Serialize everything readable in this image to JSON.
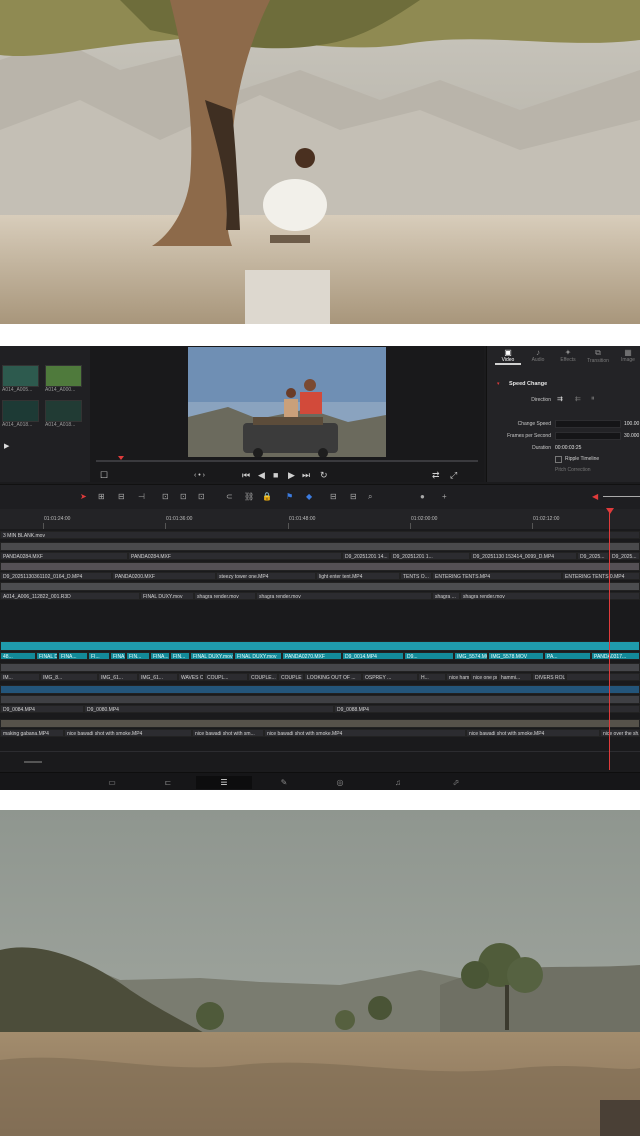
{
  "media_pool": {
    "clips": [
      {
        "label": "A014_A005..."
      },
      {
        "label": "A014_A000..."
      },
      {
        "label": "A014_A018..."
      },
      {
        "label": "A014_A018..."
      }
    ]
  },
  "inspector": {
    "tabs": [
      {
        "label": "Video",
        "icon": "video-icon"
      },
      {
        "label": "Audio",
        "icon": "audio-icon"
      },
      {
        "label": "Effects",
        "icon": "effects-icon"
      },
      {
        "label": "Transition",
        "icon": "transition-icon"
      },
      {
        "label": "Image",
        "icon": "image-icon"
      }
    ],
    "section_title": "Speed Change",
    "direction_label": "Direction",
    "change_speed_label": "Change Speed",
    "change_speed_value": "100.00",
    "fps_label": "Frames per Second",
    "fps_value": "30.000",
    "duration_label": "Duration",
    "duration_value": "00:00:03:25",
    "ripple_label": "Ripple Timeline",
    "pitch_label": "Pitch Correction",
    "ripple_checked": false
  },
  "ruler": {
    "timecodes": [
      "01:01:24:00",
      "01:01:36:00",
      "01:01:48:00",
      "01:02:00:00",
      "01:02:12:00"
    ]
  },
  "tracks": {
    "title_row": "3 MIN BLANK.mov",
    "row2": [
      "PANDA0284.MXF",
      "PANDA0284.MXF",
      "D9_20251201 14...",
      "D9_20251201 1...",
      "D9_20251130 153414_0099_D.MP4",
      "D9_2025...",
      "D9_2025..."
    ],
    "row3": [
      "D9_20251130361102_0164_D.MP4",
      "PANDA0200.MXF",
      "steezy tower one.MP4",
      "light enter tent.MP4",
      "TENTS O...",
      "ENTERING TENTS.MP4",
      "ENTERING TENTS 0.MP4"
    ],
    "row4": [
      "A014_A006_112822_001.R3D",
      "FINAL DUXY.mov",
      "shagra render.mov",
      "shagra render.mov",
      "shagra ...",
      "shagra render.mov"
    ],
    "teal_row": [
      "48...",
      "FINAL D...",
      "FINA...",
      "FI...",
      "FINA...",
      "FIN...",
      "FINA...",
      "FIN...",
      "FINAL DUXY.mov",
      "FINAL DUXY.mov",
      "PANDA0270.MXF",
      "D9_0014.MP4",
      "D9...",
      "IMG_5574.MOV",
      "IMG_5578.MOV",
      "PA...",
      "PANDA0317..."
    ],
    "row6": [
      "IM...",
      "IMG_8...",
      "IMG_61...",
      "IMG_61...",
      "WAVES ON SH...",
      "COUPL...",
      "COUPLE...",
      "COUPLE TOP DOW...",
      "LOOKING OUT OF ...",
      "OSPREY ...",
      "H...",
      "nice ham...",
      "nice one pr...",
      "hammi...",
      "DIVERS ROLL IN LIVING I..."
    ],
    "row7": [
      "D9_0084.MP4",
      "D9_0080.MP4",
      "D9_0088.MP4"
    ],
    "row8": [
      "making gabana.MP4",
      "nice bawadi shot with smoke.MP4",
      "nice bawadi shot with sm...",
      "nice bawadi shot with smoke.MP4",
      "nice bawadi shot with smoke.MP4",
      "nice over the sh..."
    ]
  },
  "page_nav": [
    {
      "name": "media",
      "icon": "media-icon"
    },
    {
      "name": "cut",
      "icon": "cut-icon"
    },
    {
      "name": "edit",
      "icon": "edit-icon"
    },
    {
      "name": "fusion",
      "icon": "fusion-icon"
    },
    {
      "name": "color",
      "icon": "color-icon"
    },
    {
      "name": "fairlight",
      "icon": "fairlight-icon"
    },
    {
      "name": "deliver",
      "icon": "deliver-icon"
    }
  ],
  "colors": {
    "accent_teal": "#1f9bac",
    "playhead_red": "#e03b3b",
    "panel_bg": "#1b1b1d"
  }
}
